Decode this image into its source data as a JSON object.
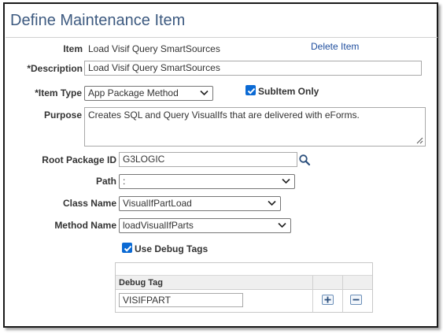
{
  "page": {
    "title": "Define Maintenance Item"
  },
  "item": {
    "label": "Item",
    "value": "Load Visif Query SmartSources",
    "delete_link": "Delete Item"
  },
  "description": {
    "label": "*Description",
    "value": "Load Visif Query SmartSources"
  },
  "item_type": {
    "label": "*Item Type",
    "value": "App Package Method"
  },
  "subitem_only": {
    "label": "SubItem Only",
    "checked": true
  },
  "purpose": {
    "label": "Purpose",
    "value": "Creates SQL and Query VisualIfs that are delivered with eForms."
  },
  "root_package_id": {
    "label": "Root Package ID",
    "value": "G3LOGIC",
    "icon": "search-icon"
  },
  "path": {
    "label": "Path",
    "value": ":"
  },
  "class_name": {
    "label": "Class Name",
    "value": "VisualIfPartLoad"
  },
  "method_name": {
    "label": "Method Name",
    "value": "loadVisualIfParts"
  },
  "use_debug_tags": {
    "label": "Use Debug Tags",
    "checked": true
  },
  "debug_grid": {
    "column_header": "Debug Tag",
    "rows": [
      {
        "tag": "VISIFPART",
        "add_icon": "plus-icon",
        "remove_icon": "minus-icon"
      }
    ]
  },
  "colors": {
    "title": "#3d5a80",
    "link": "#1f4e9e",
    "checkbox": "#0b6ad4"
  }
}
